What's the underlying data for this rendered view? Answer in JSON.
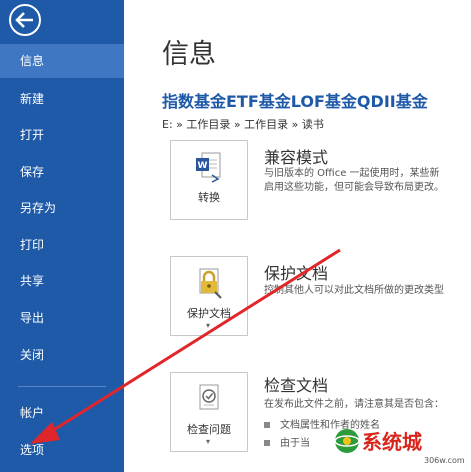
{
  "sidebar": {
    "items": [
      {
        "label": "信息",
        "active": true
      },
      {
        "label": "新建"
      },
      {
        "label": "打开"
      },
      {
        "label": "保存"
      },
      {
        "label": "另存为"
      },
      {
        "label": "打印"
      },
      {
        "label": "共享"
      },
      {
        "label": "导出"
      },
      {
        "label": "关闭"
      },
      {
        "label": "帐户"
      },
      {
        "label": "选项"
      }
    ]
  },
  "main": {
    "page_title": "信息",
    "doc_title": "指数基金ETF基金LOF基金QDII基金",
    "path": "E: » 工作目录 » 工作目录 » 读书",
    "sections": [
      {
        "button_label": "转换",
        "title": "兼容模式",
        "desc_line1": "与旧版本的 Office 一起使用时，某些新",
        "desc_line2": "启用这些功能，但可能会导致布局更改。"
      },
      {
        "button_label": "保护文档",
        "title": "保护文档",
        "desc_line1": "控制其他人可以对此文档所做的更改类型"
      },
      {
        "button_label": "检查问题",
        "title": "检查文档",
        "desc_line1": "在发布此文件之前，请注意其是否包含：",
        "bullet1": "文档属性和作者的姓名",
        "bullet2": "由于当"
      }
    ]
  },
  "watermark": {
    "text": "系统城",
    "url": "306w.com"
  },
  "colors": {
    "sidebar_bg": "#1f5aa8",
    "sidebar_active": "#3f77c2",
    "arrow": "#e0262b"
  },
  "icons": {
    "back": "back-arrow-icon",
    "convert": "word-convert-icon",
    "protect": "lock-key-icon",
    "inspect": "document-check-icon"
  }
}
